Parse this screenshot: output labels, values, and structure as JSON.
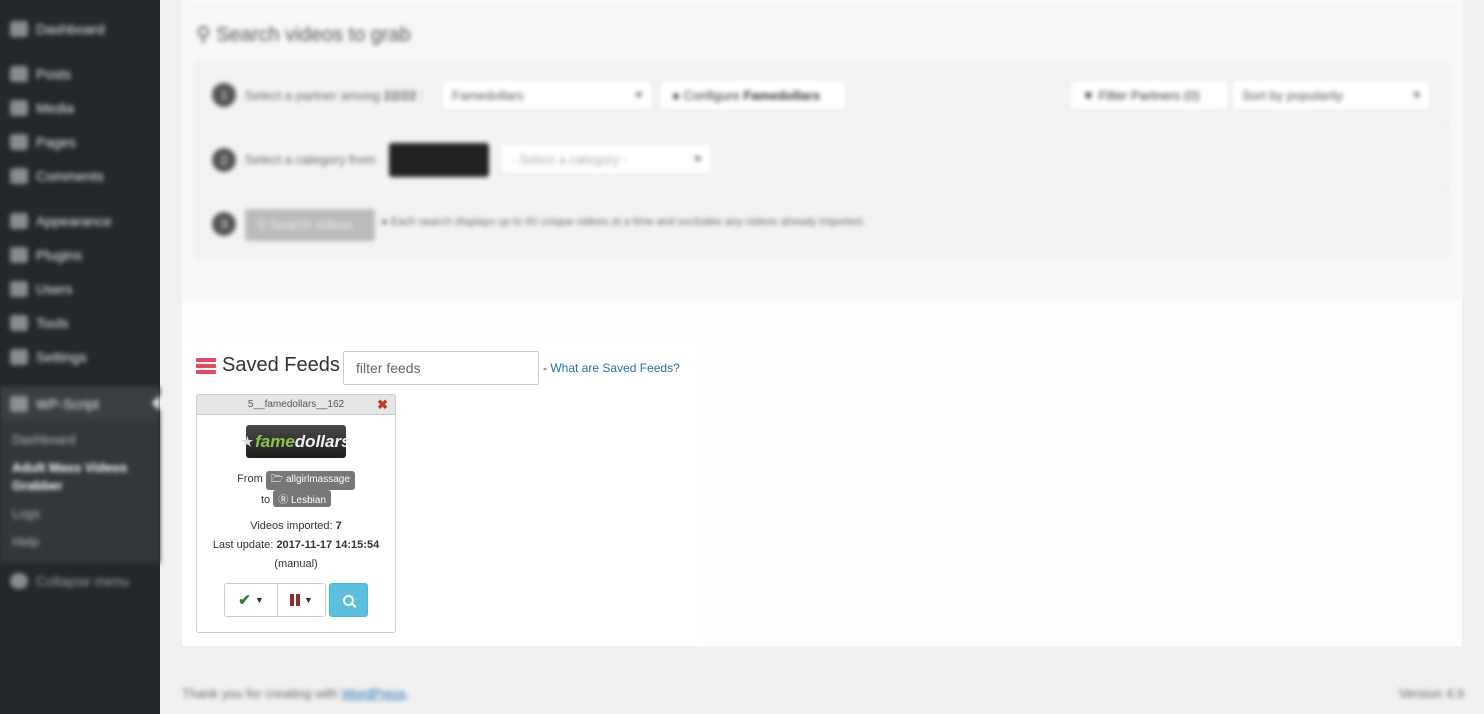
{
  "sidebar": {
    "items": [
      {
        "label": "Dashboard",
        "icon": "dashboard-icon"
      },
      {
        "label": "Posts",
        "icon": "pin-icon"
      },
      {
        "label": "Media",
        "icon": "media-icon"
      },
      {
        "label": "Pages",
        "icon": "pages-icon"
      },
      {
        "label": "Comments",
        "icon": "comment-icon"
      },
      {
        "label": "Appearance",
        "icon": "brush-icon"
      },
      {
        "label": "Plugins",
        "icon": "plug-icon"
      },
      {
        "label": "Users",
        "icon": "users-icon"
      },
      {
        "label": "Tools",
        "icon": "wrench-icon"
      },
      {
        "label": "Settings",
        "icon": "settings-icon"
      },
      {
        "label": "WP-Script",
        "icon": "play-icon"
      },
      {
        "label": "Collapse menu",
        "icon": "collapse-icon"
      }
    ],
    "submenu": [
      "Dashboard",
      "Adult Mass Videos Grabber",
      "Logs",
      "Help"
    ]
  },
  "search": {
    "title": "Search videos to grab",
    "step1_label": "Select a partner among",
    "step1_count": "22/22",
    "partner_selected": "Famedollars",
    "configure_label": "Configure",
    "configure_partner": "Famedollars",
    "filter_partners": "Filter Partners (0)",
    "sort_selected": "Sort by popularity",
    "step2_label": "Select a category from",
    "category_placeholder": "- Select a category -",
    "search_button": "Search videos",
    "step3_note": "Each search displays up to 60 unique videos at a time and excludes any videos already imported."
  },
  "saved_feeds": {
    "title": "Saved Feeds",
    "filter_placeholder": "filter feeds",
    "link_prefix": "-",
    "link_text": "What are Saved Feeds?",
    "feeds": [
      {
        "id": "5__famedollars__162",
        "partner_logo_text_1": "fame",
        "partner_logo_text_2": "dollars",
        "from_label": "From",
        "from_tag": "allgirlmassage",
        "to_label": "to",
        "to_tag": "Lesbian",
        "videos_imported_label": "Videos imported:",
        "videos_imported": "7",
        "last_update_label": "Last update:",
        "last_update": "2017-11-17 14:15:54",
        "update_mode": "(manual)"
      }
    ]
  },
  "footer": {
    "thanks": "Thank you for creating with",
    "wp_link": "WordPress",
    "version": "Version 4.9"
  },
  "colors": {
    "sidebar_bg": "#23282d",
    "accent_link": "#2271b1",
    "saved_feeds_icon": "#e8485f",
    "search_button": "#5bc0de",
    "check_green": "#2e7d32",
    "pause_red": "#8e2b2b",
    "close_red": "#c0392b"
  }
}
